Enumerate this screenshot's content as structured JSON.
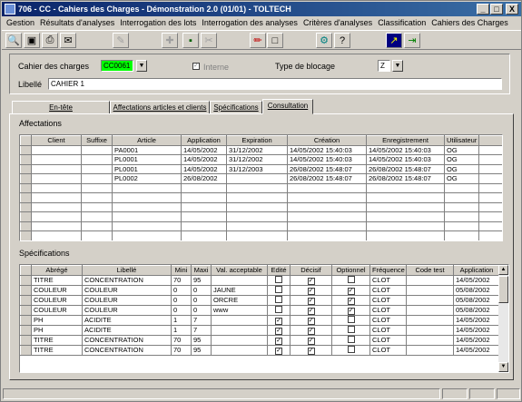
{
  "window": {
    "title": "706 - CC - Cahiers des Charges - Démonstration 2.0 (01/01) - TOLTECH",
    "min": "_",
    "max": "□",
    "close": "X"
  },
  "menu": [
    "Gestion",
    "Résultats d'analyses",
    "Interrogation des lots",
    "Interrogation des analyses",
    "Critères d'analyses",
    "Classification",
    "Cahiers des Charges"
  ],
  "form": {
    "cahier_label": "Cahier des charges",
    "cahier_value": "CC0061",
    "interne_label": "Interne",
    "blocage_label": "Type de blocage",
    "blocage_value": "Z",
    "libelle_label": "Libellé",
    "libelle_value": "CAHIER 1"
  },
  "tabs": [
    "En-tête",
    "Affectations articles et clients",
    "Spécifications",
    "Consultation"
  ],
  "affectations": {
    "title": "Affectations",
    "headers": [
      "Client",
      "Suffixe",
      "Article",
      "Application",
      "Expiration",
      "Création",
      "Enregistrement",
      "Utilisateur"
    ],
    "rows": [
      [
        "",
        "",
        "PA0001",
        "14/05/2002",
        "31/12/2002",
        "14/05/2002 15:40:03",
        "14/05/2002 15:40:03",
        "OG"
      ],
      [
        "",
        "",
        "PL0001",
        "14/05/2002",
        "31/12/2002",
        "14/05/2002 15:40:03",
        "14/05/2002 15:40:03",
        "OG"
      ],
      [
        "",
        "",
        "PL0001",
        "14/05/2002",
        "31/12/2003",
        "26/08/2002 15:48:07",
        "26/08/2002 15:48:07",
        "OG"
      ],
      [
        "",
        "",
        "PL0002",
        "26/08/2002",
        "",
        "26/08/2002 15:48:07",
        "26/08/2002 15:48:07",
        "OG"
      ]
    ],
    "empty_rows": 7
  },
  "specifications": {
    "title": "Spécifications",
    "headers": [
      "Abrégé",
      "Libellé",
      "Mini",
      "Maxi",
      "Val. acceptable",
      "Edité",
      "Décisif",
      "Optionnel",
      "Fréquence",
      "Code test",
      "Application"
    ],
    "rows": [
      [
        "TITRE",
        "CONCENTRATION",
        "70",
        "95",
        "",
        false,
        true,
        false,
        "CLOT",
        "",
        "14/05/2002"
      ],
      [
        "COULEUR",
        "COULEUR",
        "0",
        "0",
        "JAUNE",
        false,
        true,
        true,
        "CLOT",
        "",
        "05/08/2002"
      ],
      [
        "COULEUR",
        "COULEUR",
        "0",
        "0",
        "ORCRE",
        false,
        true,
        true,
        "CLOT",
        "",
        "05/08/2002"
      ],
      [
        "COULEUR",
        "COULEUR",
        "0",
        "0",
        "www",
        false,
        true,
        true,
        "CLOT",
        "",
        "05/08/2002"
      ],
      [
        "PH",
        "ACIDITE",
        "1",
        "7",
        "",
        true,
        true,
        false,
        "CLOT",
        "",
        "14/05/2002"
      ],
      [
        "PH",
        "ACIDITE",
        "1",
        "7",
        "",
        true,
        true,
        false,
        "CLOT",
        "",
        "14/05/2002"
      ],
      [
        "TITRE",
        "CONCENTRATION",
        "70",
        "95",
        "",
        true,
        true,
        false,
        "CLOT",
        "",
        "14/05/2002"
      ],
      [
        "TITRE",
        "CONCENTRATION",
        "70",
        "95",
        "",
        true,
        true,
        false,
        "CLOT",
        "",
        "14/05/2002"
      ]
    ]
  },
  "colors": {
    "title_bar": "#0a246a",
    "cahier_bg": "#00ff00",
    "face": "#d4d0c8"
  }
}
